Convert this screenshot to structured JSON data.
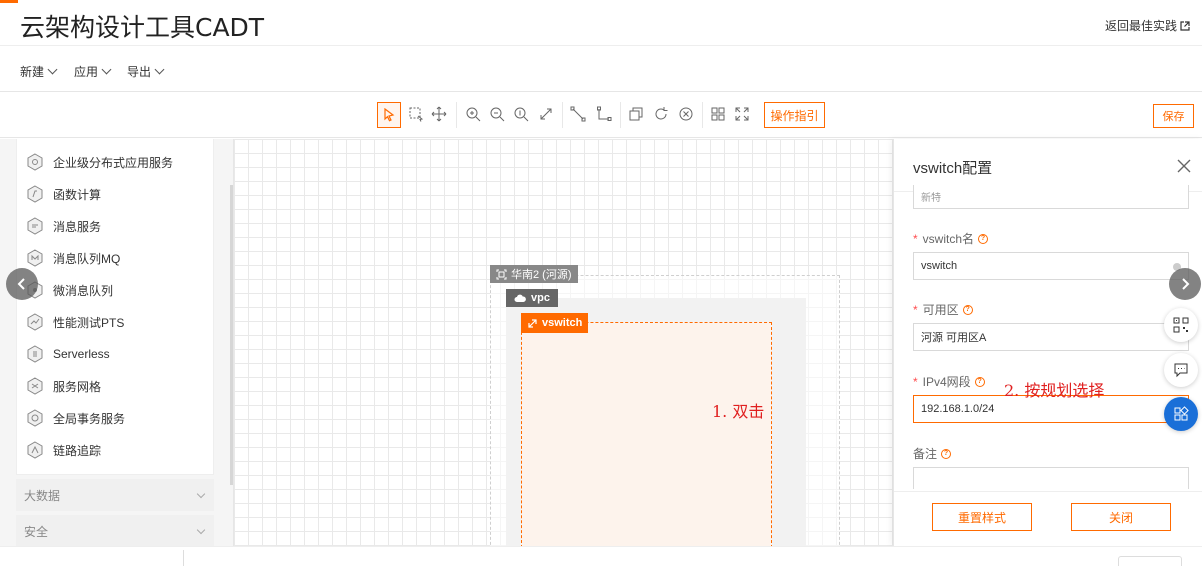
{
  "header": {
    "title": "云架构设计工具CADT",
    "best_practice_link": "返回最佳实践"
  },
  "menu": {
    "new": "新建",
    "apply": "应用",
    "export": "导出"
  },
  "toolbar": {
    "guide_label": "操作指引",
    "save_label": "保存",
    "accent_color": "#ff6a00"
  },
  "sidebar": {
    "items": [
      {
        "label": "企业级分布式应用服务",
        "icon": "edas-icon"
      },
      {
        "label": "函数计算",
        "icon": "function-compute-icon"
      },
      {
        "label": "消息服务",
        "icon": "message-service-icon"
      },
      {
        "label": "消息队列MQ",
        "icon": "mq-icon"
      },
      {
        "label": "微消息队列",
        "icon": "micro-mq-icon"
      },
      {
        "label": "性能测试PTS",
        "icon": "pts-icon"
      },
      {
        "label": "Serverless",
        "icon": "serverless-icon"
      },
      {
        "label": "服务网格",
        "icon": "service-mesh-icon"
      },
      {
        "label": "全局事务服务",
        "icon": "gts-icon"
      },
      {
        "label": "链路追踪",
        "icon": "tracing-icon"
      }
    ],
    "categories": [
      "大数据",
      "安全"
    ]
  },
  "canvas": {
    "region_label": "华南2 (河源)",
    "vpc_label": "vpc",
    "vswitch_label": "vswitch",
    "annotation_1": "1. 双击"
  },
  "panel": {
    "title": "vswitch配置",
    "partial_field_value": "新特",
    "name_label": "vswitch名",
    "name_value": "vswitch",
    "zone_label": "可用区",
    "zone_value": "河源 可用区A",
    "ipv4_label": "IPv4网段",
    "ipv4_value": "192.168.1.0/24",
    "remark_label": "备注",
    "reset_button": "重置样式",
    "close_button": "关闭",
    "annotation_2": "2. 按规划选择"
  }
}
